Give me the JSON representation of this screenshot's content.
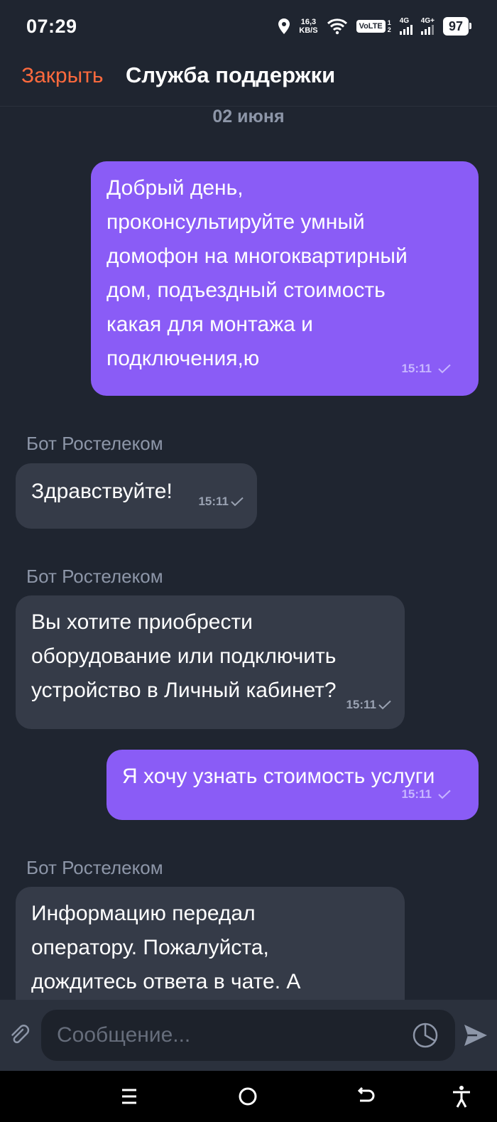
{
  "status_bar": {
    "time": "07:29",
    "net_speed_value": "16,3",
    "net_speed_unit": "KB/S",
    "volte": "VoLTE",
    "sim_numbers": [
      "1",
      "2"
    ],
    "sim1_gen": "4G",
    "sim2_gen": "4G+",
    "battery": "97"
  },
  "header": {
    "close_label": "Закрыть",
    "title": "Служба поддержки"
  },
  "chat": {
    "date_separator": "02 июня",
    "messages": [
      {
        "direction": "out",
        "lines": [
          "Добрый день,",
          "проконсультируйте умный",
          "домофон на многоквартирный",
          "дом, подъездный стоимость",
          "какая для монтажа и",
          "подключения,ю"
        ],
        "time": "15:11"
      },
      {
        "direction": "in",
        "sender": "Бот Ростелеком",
        "lines": [
          "Здравствуйте!"
        ],
        "time": "15:11"
      },
      {
        "direction": "in",
        "sender": "Бот Ростелеком",
        "lines": [
          "Вы хотите приобрести",
          "оборудование или подключить",
          "устройство в Личный кабинет?"
        ],
        "time": "15:11"
      },
      {
        "direction": "out",
        "lines": [
          "Я хочу узнать стоимость услуги"
        ],
        "time": "15:11"
      },
      {
        "direction": "in",
        "sender": "Бот Ростелеком",
        "lines": [
          "Информацию передал",
          "оператору. Пожалуйста,",
          "дождитесь ответа в чате. А"
        ]
      }
    ]
  },
  "composer": {
    "placeholder": "Сообщение..."
  },
  "icons": {
    "attach": "paperclip-icon",
    "sticker": "sticker-icon",
    "send": "send-icon",
    "check": "check-icon",
    "nav_menu": "menu-icon",
    "nav_home": "home-icon",
    "nav_back": "back-icon",
    "nav_accessibility": "accessibility-icon"
  },
  "colors": {
    "background": "#1f2530",
    "accent_close": "#ff6a3d",
    "outgoing_bubble": "#8a5cf6",
    "incoming_bubble": "#353b48"
  }
}
